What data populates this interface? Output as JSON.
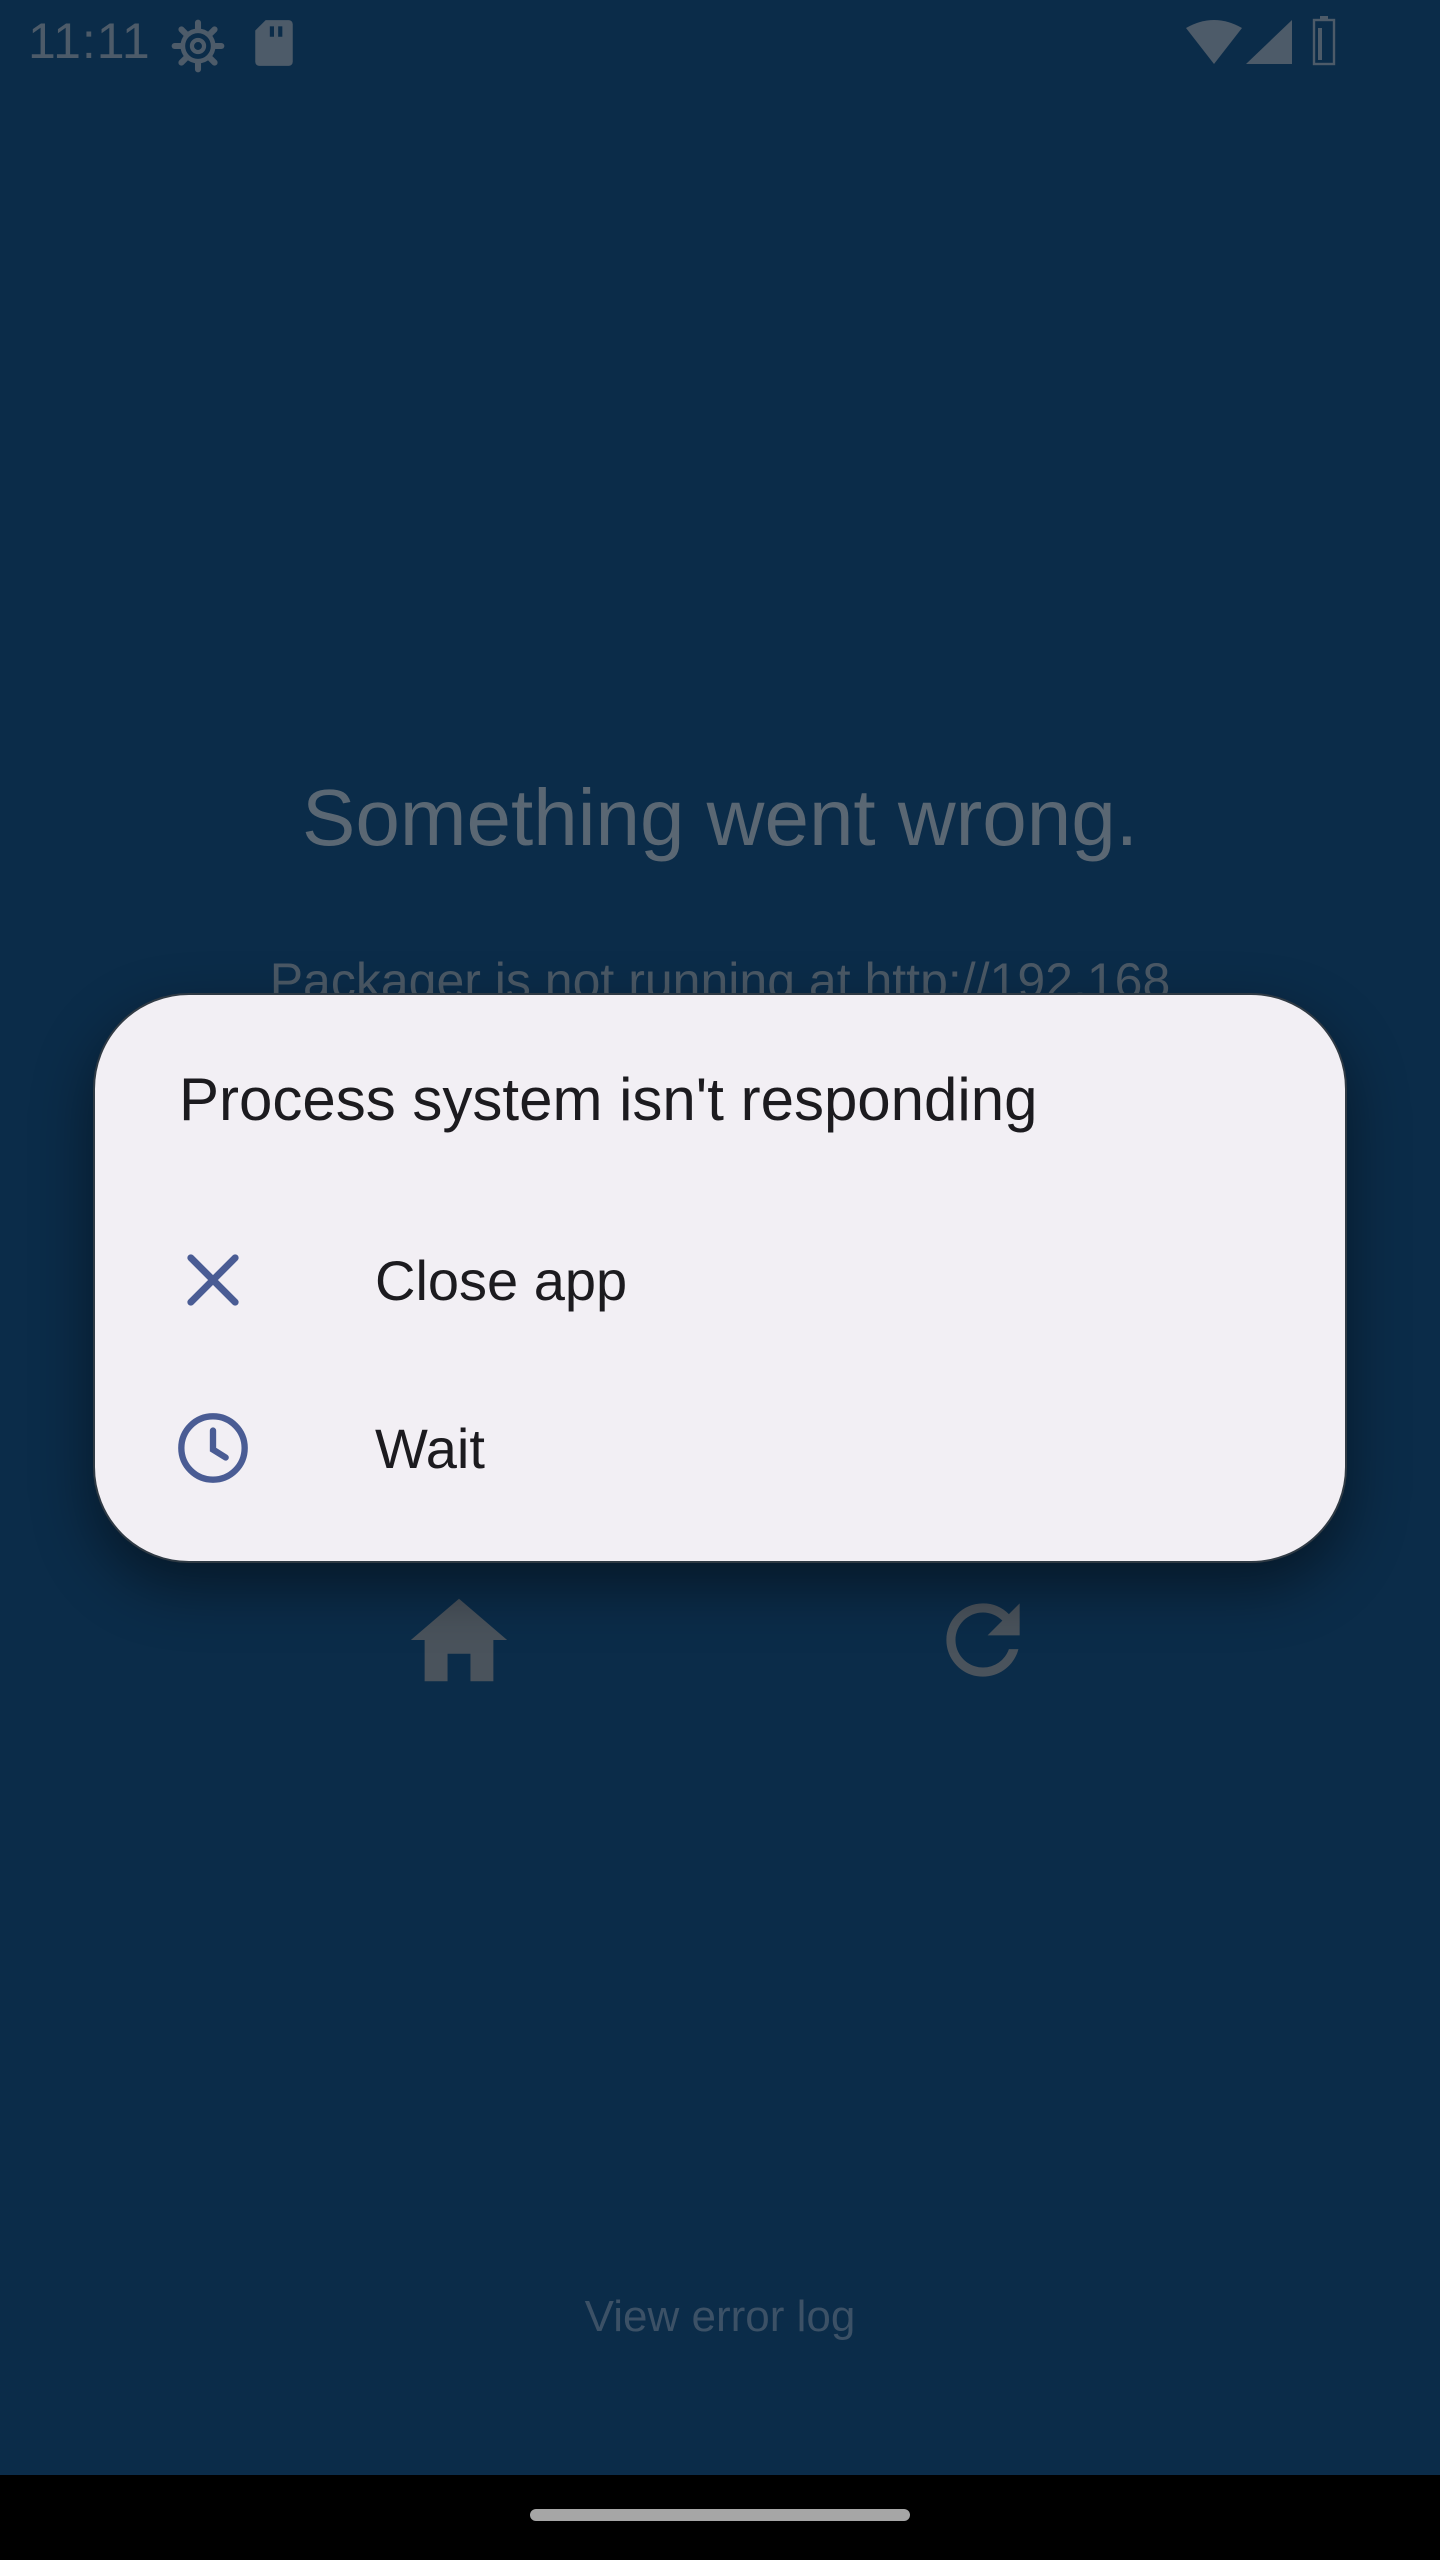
{
  "status_bar": {
    "time": "11:11",
    "left_icons": [
      "settings-icon",
      "sd-card-icon"
    ],
    "right_icons": [
      "wifi-icon",
      "signal-icon",
      "battery-icon"
    ]
  },
  "background": {
    "error_title": "Something went wrong.",
    "error_detail": "Packager is not running at http://192.168",
    "home_icon": "home-icon",
    "reload_icon": "reload-icon",
    "view_error_log": "View error log"
  },
  "dialog": {
    "title": "Process system isn't responding",
    "options": [
      {
        "label": "Close app",
        "icon": "close-icon"
      },
      {
        "label": "Wait",
        "icon": "clock-icon"
      }
    ]
  },
  "colors": {
    "background": "#0b2c49",
    "dialog": "#f2eff4",
    "accent": "#4a5c94",
    "text": "#1c1b1f"
  }
}
